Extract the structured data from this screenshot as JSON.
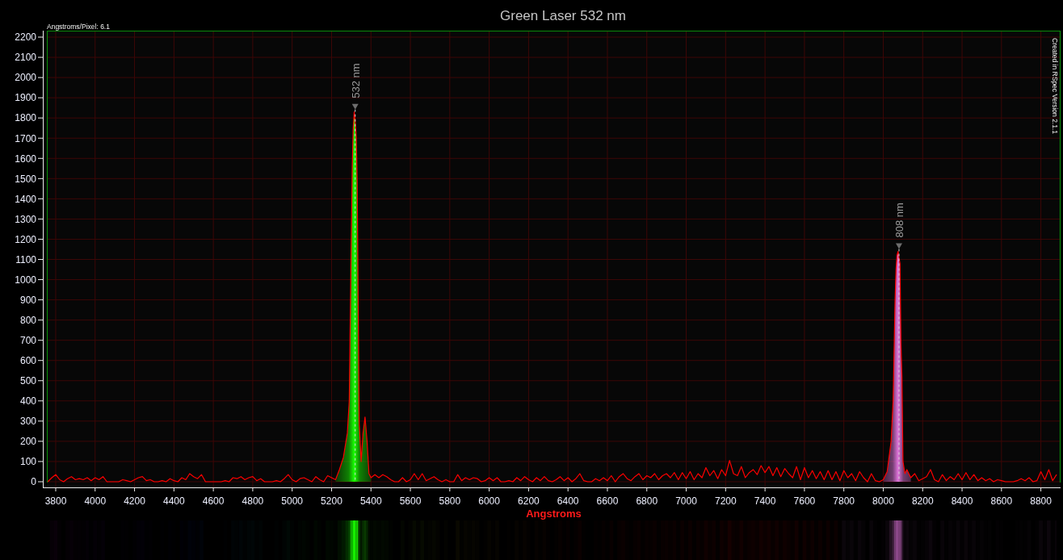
{
  "spectrum_chart": {
    "scale_note": "Angstroms/Pixel: 6.1",
    "credit": "Created in RSpec Version 2.1.1",
    "chart_data": {
      "type": "line",
      "title": "Green Laser 532 nm",
      "xlabel": "Angstroms",
      "x": [
        3760,
        3780,
        3800,
        3820,
        3840,
        3860,
        3880,
        3900,
        3920,
        3940,
        3960,
        3980,
        4000,
        4020,
        4040,
        4060,
        4080,
        4100,
        4120,
        4140,
        4160,
        4180,
        4200,
        4220,
        4240,
        4260,
        4280,
        4300,
        4320,
        4340,
        4360,
        4380,
        4400,
        4420,
        4440,
        4460,
        4480,
        4500,
        4520,
        4540,
        4560,
        4580,
        4600,
        4620,
        4640,
        4660,
        4680,
        4700,
        4720,
        4740,
        4760,
        4780,
        4800,
        4820,
        4840,
        4860,
        4880,
        4900,
        4920,
        4940,
        4960,
        4980,
        5000,
        5020,
        5040,
        5060,
        5080,
        5100,
        5120,
        5140,
        5160,
        5180,
        5200,
        5220,
        5240,
        5260,
        5280,
        5290,
        5300,
        5305,
        5310,
        5315,
        5320,
        5325,
        5330,
        5340,
        5350,
        5360,
        5370,
        5380,
        5390,
        5400,
        5420,
        5440,
        5460,
        5480,
        5500,
        5520,
        5540,
        5560,
        5580,
        5600,
        5620,
        5640,
        5660,
        5680,
        5700,
        5720,
        5740,
        5760,
        5780,
        5800,
        5820,
        5840,
        5860,
        5880,
        5900,
        5920,
        5940,
        5960,
        5980,
        6000,
        6020,
        6040,
        6060,
        6080,
        6100,
        6120,
        6140,
        6160,
        6180,
        6200,
        6220,
        6240,
        6260,
        6280,
        6300,
        6320,
        6340,
        6360,
        6380,
        6400,
        6420,
        6440,
        6460,
        6480,
        6500,
        6520,
        6540,
        6560,
        6580,
        6600,
        6620,
        6640,
        6660,
        6680,
        6700,
        6720,
        6740,
        6760,
        6780,
        6800,
        6820,
        6840,
        6860,
        6880,
        6900,
        6920,
        6940,
        6960,
        6980,
        7000,
        7020,
        7040,
        7060,
        7080,
        7100,
        7120,
        7140,
        7160,
        7180,
        7200,
        7220,
        7240,
        7260,
        7280,
        7300,
        7320,
        7340,
        7360,
        7380,
        7400,
        7420,
        7440,
        7460,
        7480,
        7500,
        7520,
        7540,
        7560,
        7580,
        7600,
        7620,
        7640,
        7660,
        7680,
        7700,
        7720,
        7740,
        7760,
        7780,
        7800,
        7820,
        7840,
        7860,
        7880,
        7900,
        7920,
        7940,
        7960,
        7980,
        8000,
        8020,
        8040,
        8050,
        8060,
        8065,
        8070,
        8075,
        8080,
        8085,
        8090,
        8095,
        8100,
        8110,
        8120,
        8140,
        8160,
        8180,
        8200,
        8220,
        8240,
        8260,
        8280,
        8300,
        8320,
        8340,
        8360,
        8380,
        8400,
        8420,
        8440,
        8460,
        8480,
        8500,
        8520,
        8540,
        8560,
        8580,
        8600,
        8620,
        8640,
        8660,
        8680,
        8700,
        8720,
        8740,
        8760,
        8780,
        8800,
        8820,
        8840,
        8860,
        8880
      ],
      "series": [
        {
          "color": "#ff0000",
          "values": [
            0,
            20,
            35,
            10,
            0,
            15,
            25,
            10,
            15,
            10,
            20,
            5,
            20,
            10,
            25,
            0,
            0,
            0,
            0,
            10,
            5,
            0,
            10,
            20,
            25,
            5,
            10,
            0,
            0,
            5,
            0,
            15,
            5,
            0,
            20,
            10,
            40,
            25,
            15,
            35,
            0,
            0,
            0,
            0,
            0,
            5,
            0,
            20,
            15,
            25,
            10,
            20,
            25,
            5,
            15,
            0,
            0,
            0,
            5,
            0,
            15,
            35,
            10,
            0,
            15,
            20,
            10,
            0,
            25,
            10,
            0,
            30,
            20,
            10,
            60,
            120,
            240,
            400,
            1210,
            1560,
            1750,
            1830,
            1790,
            1710,
            1480,
            300,
            100,
            240,
            320,
            200,
            40,
            20,
            35,
            20,
            35,
            25,
            10,
            0,
            0,
            20,
            0,
            10,
            40,
            10,
            40,
            5,
            15,
            25,
            10,
            0,
            10,
            0,
            0,
            35,
            5,
            20,
            10,
            20,
            15,
            0,
            5,
            20,
            5,
            20,
            0,
            0,
            5,
            0,
            20,
            5,
            25,
            10,
            0,
            20,
            5,
            25,
            5,
            0,
            10,
            25,
            5,
            20,
            0,
            15,
            40,
            5,
            0,
            0,
            15,
            5,
            20,
            5,
            30,
            0,
            25,
            40,
            15,
            5,
            25,
            40,
            10,
            30,
            20,
            40,
            10,
            30,
            40,
            20,
            45,
            10,
            45,
            15,
            50,
            10,
            40,
            20,
            70,
            30,
            55,
            15,
            60,
            30,
            105,
            40,
            30,
            75,
            20,
            45,
            60,
            35,
            80,
            45,
            75,
            30,
            70,
            25,
            65,
            40,
            20,
            75,
            10,
            70,
            20,
            55,
            15,
            50,
            10,
            55,
            10,
            50,
            5,
            55,
            20,
            40,
            5,
            50,
            20,
            0,
            40,
            5,
            0,
            10,
            50,
            200,
            400,
            900,
            1050,
            1120,
            1140,
            1110,
            1080,
            680,
            520,
            100,
            40,
            60,
            20,
            40,
            5,
            15,
            25,
            60,
            10,
            0,
            35,
            5,
            25,
            10,
            40,
            10,
            45,
            10,
            35,
            5,
            20,
            5,
            15,
            0,
            10,
            5,
            0,
            0,
            0,
            5,
            15,
            5,
            20,
            0,
            5,
            50,
            10,
            60,
            5,
            35
          ]
        }
      ],
      "xlim": [
        3755,
        8900
      ],
      "ylim": [
        -28,
        2232
      ],
      "xticks": [
        3800,
        4000,
        4200,
        4400,
        4600,
        4800,
        5000,
        5200,
        5400,
        5600,
        5800,
        6000,
        6200,
        6400,
        6600,
        6800,
        7000,
        7200,
        7400,
        7600,
        7800,
        8000,
        8200,
        8400,
        8600,
        8800
      ],
      "yticks": [
        0,
        100,
        200,
        300,
        400,
        500,
        600,
        700,
        800,
        900,
        1000,
        1100,
        1200,
        1300,
        1400,
        1500,
        1600,
        1700,
        1800,
        1900,
        2000,
        2100,
        2200
      ],
      "grid": true,
      "ref_lines": [
        {
          "axis": "x",
          "value": 5320
        },
        {
          "axis": "x",
          "value": 8080
        }
      ],
      "annotations": [
        "532 nm",
        "808 nm"
      ]
    }
  }
}
